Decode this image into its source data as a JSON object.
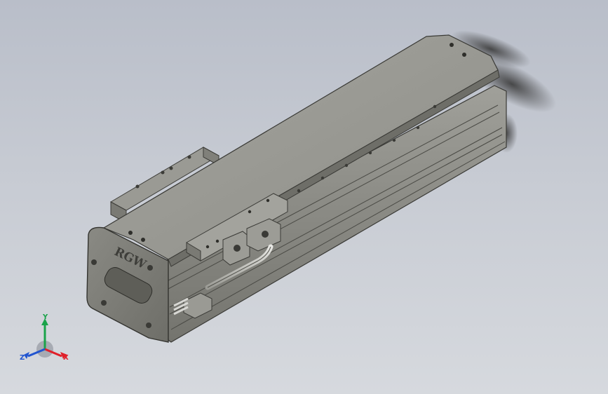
{
  "model": {
    "brand_engraving": "RGW"
  },
  "triad": {
    "x_label": "X",
    "y_label": "Y",
    "z_label": "Z",
    "x_color": "#e0202a",
    "y_color": "#1aa34a",
    "z_color": "#2255d0"
  },
  "colors": {
    "background_top": "#b9bec9",
    "background_bottom": "#d6d9de",
    "body": "#8c8c86",
    "top_cover": "#9b9b95",
    "end_plate": "#7e7e78",
    "rod": "#cfcfca"
  }
}
